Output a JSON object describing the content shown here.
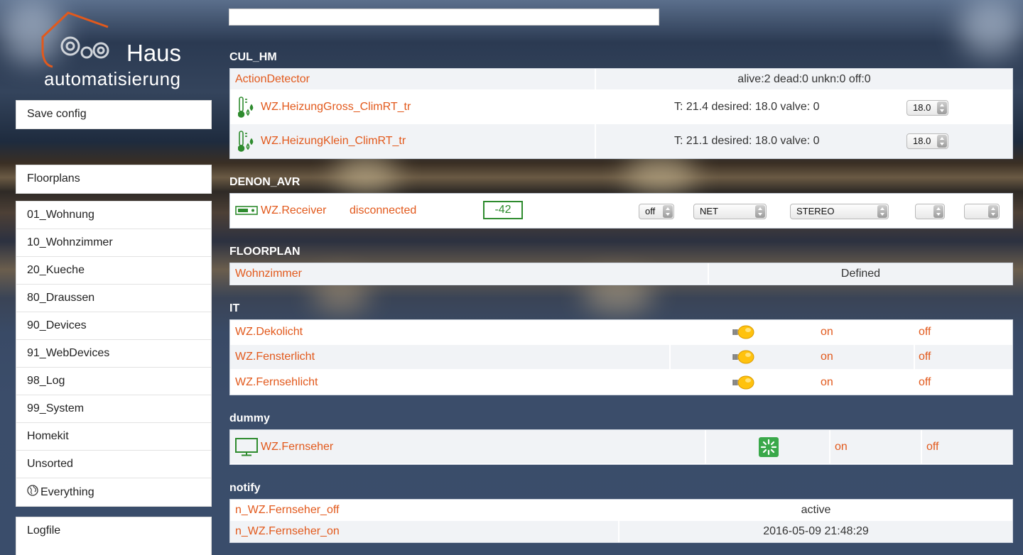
{
  "logo": {
    "line1": "Haus",
    "line2": "automatisierung"
  },
  "sidebar": {
    "save": "Save config",
    "floorplans": "Floorplans",
    "rooms": [
      "01_Wohnung",
      "10_Wohnzimmer",
      "20_Kueche",
      "80_Draussen",
      "90_Devices",
      "91_WebDevices",
      "98_Log",
      "99_System",
      "Homekit",
      "Unsorted"
    ],
    "everything": "Everything",
    "logfile": "Logfile"
  },
  "search": {
    "placeholder": ""
  },
  "groups": {
    "cul_hm": {
      "title": "CUL_HM",
      "rows": [
        {
          "name": "ActionDetector",
          "state": "alive:2 dead:0 unkn:0 off:0"
        },
        {
          "name": "WZ.HeizungGross_ClimRT_tr",
          "state": "T: 21.4 desired: 18.0 valve: 0",
          "select": "18.0",
          "icon": "thermostat-icon"
        },
        {
          "name": "WZ.HeizungKlein_ClimRT_tr",
          "state": "T: 21.1 desired: 18.0 valve: 0",
          "select": "18.0",
          "icon": "thermostat-icon"
        }
      ]
    },
    "denon": {
      "title": "DENON_AVR",
      "name": "WZ.Receiver",
      "state": "disconnected",
      "volume": "-42",
      "sel_power": "off",
      "sel_input": "NET",
      "sel_mode": "STEREO",
      "sel_a": "",
      "sel_b": ""
    },
    "floorplan": {
      "title": "FLOORPLAN",
      "name": "Wohnzimmer",
      "state": "Defined"
    },
    "it": {
      "title": "IT",
      "rows": [
        {
          "name": "WZ.Dekolicht",
          "on": "on",
          "off": "off"
        },
        {
          "name": "WZ.Fensterlicht",
          "on": "on",
          "off": "off"
        },
        {
          "name": "WZ.Fernsehlicht",
          "on": "on",
          "off": "off"
        }
      ]
    },
    "dummy": {
      "title": "dummy",
      "name": "WZ.Fernseher",
      "on": "on",
      "off": "off"
    },
    "notify": {
      "title": "notify",
      "rows": [
        {
          "name": "n_WZ.Fernseher_off",
          "state": "active"
        },
        {
          "name": "n_WZ.Fernseher_on",
          "state": "2016-05-09 21:48:29"
        }
      ]
    }
  },
  "colors": {
    "link": "#e2591c",
    "accent_green": "#2e8b2e",
    "header": "#ffffff"
  }
}
